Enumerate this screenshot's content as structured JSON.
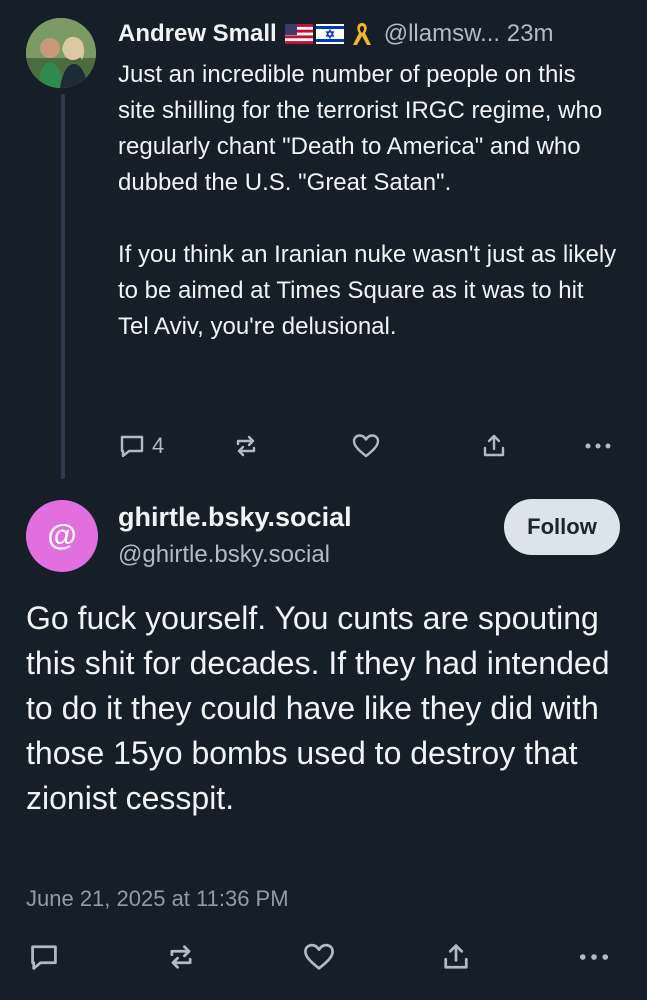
{
  "parent_post": {
    "display_name": "Andrew Small",
    "handle_time": "@llamsw... 23m",
    "text": "Just an incredible number of people on this site shilling for the terrorist IRGC regime, who regularly chant \"Death to America\" and who dubbed the U.S. \"Great Satan\".\n\nIf you think an Iranian nuke wasn't just as likely to be aimed at Times Square as it was to hit Tel Aviv, you're delusional.",
    "reply_count": "4",
    "icons": {
      "reply": "speech-bubble-icon",
      "repost": "repost-icon",
      "like": "heart-icon",
      "share": "share-icon",
      "more": "more-dots-icon"
    }
  },
  "reply_post": {
    "avatar_symbol": "@",
    "display_name": "ghirtle.bsky.social",
    "handle": "@ghirtle.bsky.social",
    "follow_label": "Follow",
    "text": "Go fuck yourself. You cunts are spouting this shit for decades. If they had intended to do it they could have like they did with those 15yo bombs used to destroy that zionist cesspit.",
    "timestamp": "June 21, 2025 at 11:36 PM"
  },
  "colors": {
    "background": "#161e27",
    "text_primary": "#f1f3f5",
    "text_secondary": "#aebbc9",
    "avatar_ghirtle": "#e26fe0",
    "follow_button_bg": "#dde3ea",
    "thread_line": "#2e3b4b"
  }
}
